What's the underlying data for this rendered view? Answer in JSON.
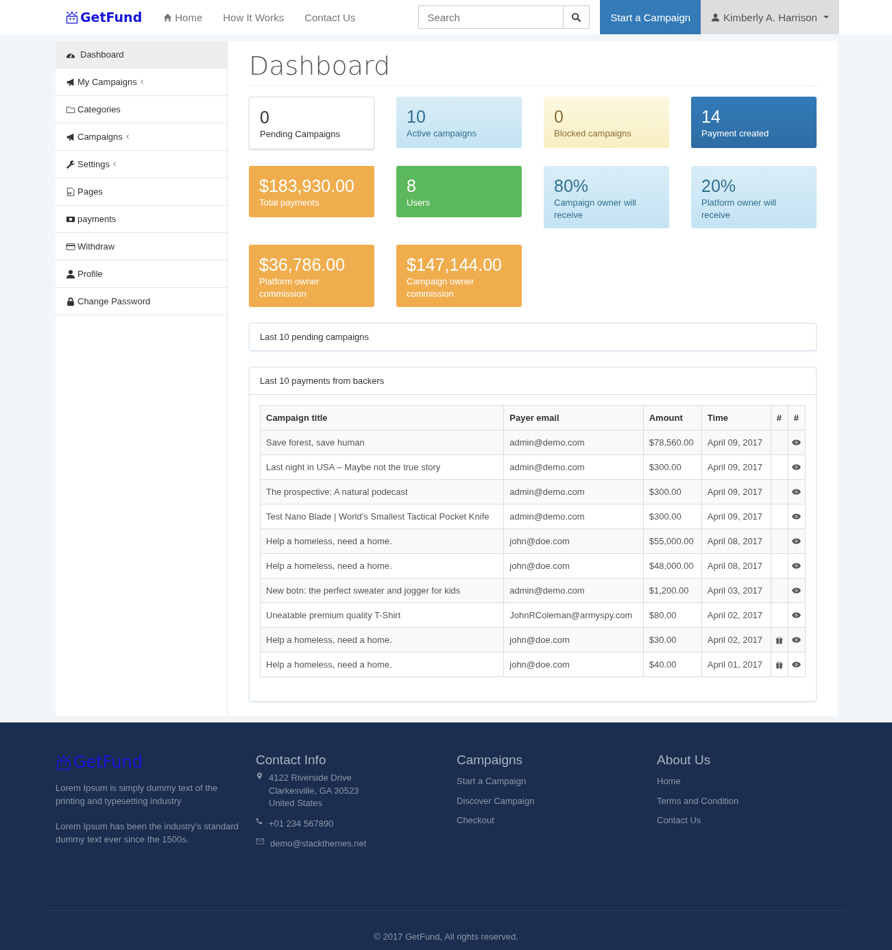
{
  "navbar": {
    "brand": "GetFund",
    "links": [
      {
        "label": "Home"
      },
      {
        "label": "How It Works"
      },
      {
        "label": "Contact Us"
      }
    ],
    "search": {
      "placeholder": "Search"
    },
    "cta": "Start a Campaign",
    "user": "Kimberly A. Harrison"
  },
  "sidebar": {
    "items": [
      {
        "label": "Dashboard",
        "selected": true,
        "expandable": false
      },
      {
        "label": "My Campaigns",
        "selected": false,
        "expandable": true
      },
      {
        "label": "Categories",
        "selected": false,
        "expandable": false
      },
      {
        "label": "Campaigns",
        "selected": false,
        "expandable": true
      },
      {
        "label": "Settings",
        "selected": false,
        "expandable": true
      },
      {
        "label": "Pages",
        "selected": false,
        "expandable": false
      },
      {
        "label": "payments",
        "selected": false,
        "expandable": false
      },
      {
        "label": "Withdraw",
        "selected": false,
        "expandable": false
      },
      {
        "label": "Profile",
        "selected": false,
        "expandable": false
      },
      {
        "label": "Change Password",
        "selected": false,
        "expandable": false
      }
    ]
  },
  "page_title": "Dashboard",
  "stats": [
    {
      "value": "0",
      "label": "Pending Campaigns",
      "kind": "default"
    },
    {
      "value": "10",
      "label": "Active campaigns",
      "kind": "info"
    },
    {
      "value": "0",
      "label": "Blocked campaigns",
      "kind": "warning"
    },
    {
      "value": "14",
      "label": "Payment created",
      "kind": "primary"
    },
    {
      "value": "$183,930.00",
      "label": "Total payments",
      "kind": "orange"
    },
    {
      "value": "8",
      "label": "Users",
      "kind": "success"
    },
    {
      "value": "80%",
      "label": "Campaign owner will receive",
      "kind": "info"
    },
    {
      "value": "20%",
      "label": "Platform owner will receive",
      "kind": "info"
    },
    {
      "value": "$36,786.00",
      "label": "Platform owner commission",
      "kind": "orange"
    },
    {
      "value": "$147,144.00",
      "label": "Campaign owner commission",
      "kind": "orange"
    }
  ],
  "pending_panel": {
    "title": "Last 10 pending campaigns"
  },
  "payments_panel": {
    "title": "Last 10 payments from backers",
    "table": {
      "columns": [
        "Campaign title",
        "Payer email",
        "Amount",
        "Time",
        "#",
        "#"
      ],
      "rows": [
        {
          "title": "Save forest, save human",
          "email": "admin@demo.com",
          "amount": "$78,560.00",
          "time": "April 09, 2017",
          "gift": false
        },
        {
          "title": "Last night in USA – Maybe not the true story",
          "email": "admin@demo.com",
          "amount": "$300.00",
          "time": "April 09, 2017",
          "gift": false
        },
        {
          "title": "The prospective: A natural podecast",
          "email": "admin@demo.com",
          "amount": "$300.00",
          "time": "April 09, 2017",
          "gift": false
        },
        {
          "title": "Test Nano Blade | World's Smallest Tactical Pocket Knife",
          "email": "admin@demo.com",
          "amount": "$300.00",
          "time": "April 09, 2017",
          "gift": false
        },
        {
          "title": "Help a homeless, need a home.",
          "email": "john@doe.com",
          "amount": "$55,000.00",
          "time": "April 08, 2017",
          "gift": false
        },
        {
          "title": "Help a homeless, need a home.",
          "email": "john@doe.com",
          "amount": "$48,000.00",
          "time": "April 08, 2017",
          "gift": false
        },
        {
          "title": "New botn: the perfect sweater and jogger for kids",
          "email": "admin@demo.com",
          "amount": "$1,200.00",
          "time": "April 03, 2017",
          "gift": false
        },
        {
          "title": "Uneatable premium quality T-Shirt",
          "email": "JohnRColeman@armyspy.com",
          "amount": "$80.00",
          "time": "April 02, 2017",
          "gift": false
        },
        {
          "title": "Help a homeless, need a home.",
          "email": "john@doe.com",
          "amount": "$30.00",
          "time": "April 02, 2017",
          "gift": true
        },
        {
          "title": "Help a homeless, need a home.",
          "email": "john@doe.com",
          "amount": "$40.00",
          "time": "April 01, 2017",
          "gift": true
        }
      ]
    }
  },
  "footer": {
    "brand": "GetFund",
    "about": [
      "Lorem Ipsum is simply dummy text of the printing and typesetting industry",
      "Lorem Ipsum has been the industry's standard dummy text ever since the 1500s."
    ],
    "contact": {
      "title": "Contact Info",
      "address": [
        "4122 Riverside Drive",
        "Clarkesville, GA 30523",
        "United States"
      ],
      "phone": "+01 234 567890",
      "email": "demo@stackthemes.net"
    },
    "campaigns": {
      "title": "Campaigns",
      "links": [
        "Start a Campaign",
        "Discover Campaign",
        "Checkout"
      ]
    },
    "about_us": {
      "title": "About Us",
      "links": [
        "Home",
        "Terms and Condition",
        "Contact Us"
      ]
    },
    "copyright": "© 2017 GetFund, All rights reserved."
  }
}
